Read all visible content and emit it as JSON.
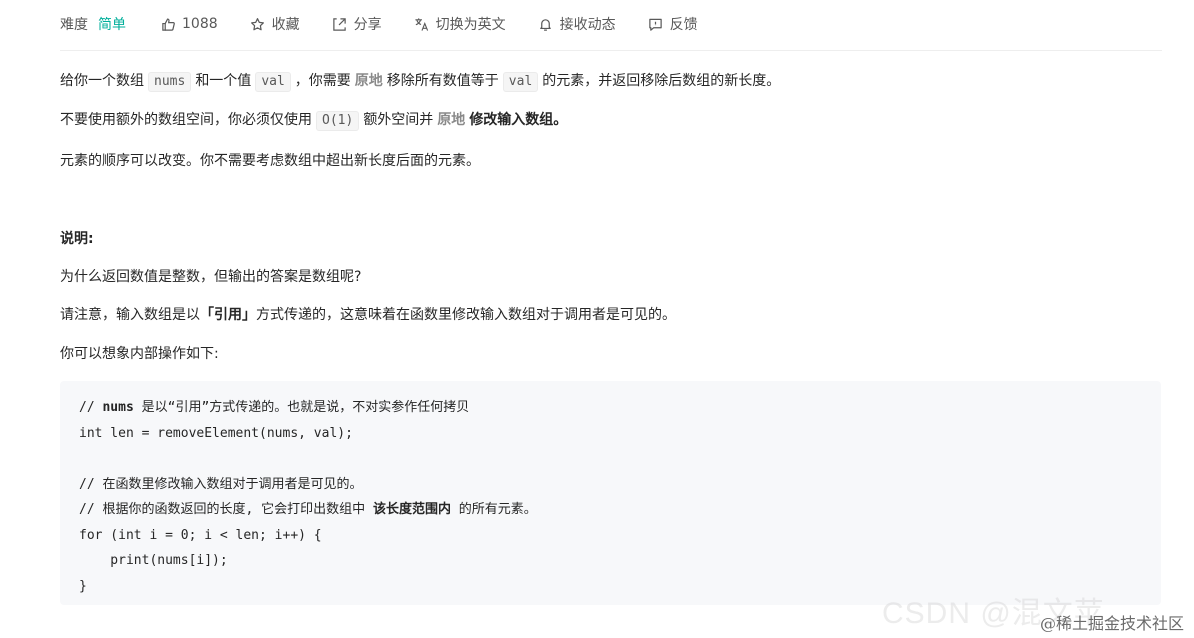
{
  "toolbar": {
    "difficulty_label": "难度",
    "difficulty_value": "简单",
    "likes": "1088",
    "favorite": "收藏",
    "share": "分享",
    "translate": "切换为英文",
    "notify": "接收动态",
    "feedback": "反馈",
    "difficulty_color": "#00af9b",
    "icons": [
      "thumbs-up-icon",
      "star-icon",
      "share-icon",
      "translate-icon",
      "bell-icon",
      "feedback-icon"
    ]
  },
  "description": {
    "p1": {
      "a": "给你一个数组",
      "code1": "nums",
      "b": "和一个值",
      "code2": "val",
      "c": "，你需要",
      "em": "原地",
      "d": "移除所有数值等于",
      "code3": "val",
      "e": "的元素，并返回移除后数组的新长度。"
    },
    "p2": {
      "a": "不要使用额外的数组空间，你必须仅使用",
      "code": "O(1)",
      "b": "额外空间并",
      "em": "原地",
      "strong": "修改输入数组。"
    },
    "p3": "元素的顺序可以改变。你不需要考虑数组中超出新长度后面的元素。"
  },
  "note": {
    "heading": "说明:",
    "q": "为什么返回数值是整数，但输出的答案是数组呢?",
    "p": {
      "a": "请注意，输入数组是以",
      "strong": "「引用」",
      "b": "方式传递的，这意味着在函数里修改输入数组对于调用者是可见的。"
    },
    "p2": "你可以想象内部操作如下:"
  },
  "code": {
    "l1a": "// ",
    "l1b": "nums",
    "l1c": " 是以“引用”方式传递的。也就是说，不对实参作任何拷贝",
    "l2": "int len = removeElement(nums, val);",
    "l3": "",
    "l4": "// 在函数里修改输入数组对于调用者是可见的。",
    "l5a": "// 根据你的函数返回的长度, 它会打印出数组中 ",
    "l5b": "该长度范围内",
    "l5c": " 的所有元素。",
    "l6": "for (int i = 0; i < len; i++) {",
    "l7": "    print(nums[i]);",
    "l8": "}"
  },
  "watermark": {
    "csdn": "CSDN @混文苹",
    "juejin": "@稀土掘金技术社区"
  }
}
